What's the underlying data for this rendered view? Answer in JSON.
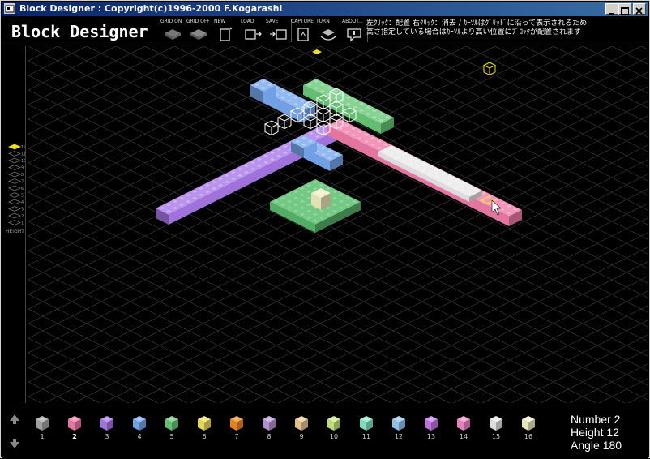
{
  "window": {
    "title": "Block Designer : Copyright(c)1996-2000  F.Kogarashi"
  },
  "toolbar": {
    "app_name": "Block Designer",
    "buttons": [
      {
        "id": "grid-on",
        "label": "GRID ON",
        "icon": "grid-on-icon"
      },
      {
        "id": "grid-off",
        "label": "GRID OFF",
        "icon": "grid-off-icon"
      },
      {
        "id": "new",
        "label": "NEW",
        "icon": "new-file-icon"
      },
      {
        "id": "load",
        "label": "LOAD",
        "icon": "load-icon"
      },
      {
        "id": "save",
        "label": "SAVE",
        "icon": "save-icon"
      },
      {
        "id": "capture",
        "label": "CAPTURE",
        "icon": "capture-icon"
      },
      {
        "id": "turn",
        "label": "TURN",
        "icon": "turn-icon"
      },
      {
        "id": "about",
        "label": "ABOUT...",
        "icon": "about-icon"
      }
    ],
    "help_line1": "左ｸﾘｯｸ：配置  右ｸﾘｯｸ：消去 / ｶｰｿﾙはｸﾞﾘｯﾄﾞに沿って表示されるため",
    "help_line2": "高さ指定している場合はｶｰｿﾙより高い位置にﾌﾞﾛｯｸが配置されます"
  },
  "height_panel": {
    "label": "HEIGHT",
    "levels": [
      "12",
      "11",
      "10",
      "9",
      "8",
      "7",
      "6",
      "5",
      "4",
      "3",
      "2",
      "1"
    ],
    "selected": "12"
  },
  "palette": {
    "selected": "2",
    "colors": [
      {
        "num": "1",
        "color": "#a8a8a8"
      },
      {
        "num": "2",
        "color": "#f07aa8"
      },
      {
        "num": "3",
        "color": "#a878e8"
      },
      {
        "num": "4",
        "color": "#78a8f0"
      },
      {
        "num": "5",
        "color": "#68c878"
      },
      {
        "num": "6",
        "color": "#f0e060"
      },
      {
        "num": "7",
        "color": "#f08820"
      },
      {
        "num": "8",
        "color": "#b898d8"
      },
      {
        "num": "9",
        "color": "#f0c890"
      },
      {
        "num": "10",
        "color": "#c8e880"
      },
      {
        "num": "11",
        "color": "#88e8c8"
      },
      {
        "num": "12",
        "color": "#98c8f0"
      },
      {
        "num": "13",
        "color": "#c878e8"
      },
      {
        "num": "14",
        "color": "#f088c8"
      },
      {
        "num": "15",
        "color": "#e8e8e8"
      },
      {
        "num": "16",
        "color": "#f0f0c8"
      }
    ]
  },
  "status": {
    "number": "Number 2",
    "height": "Height 12",
    "angle": "Angle 180"
  },
  "scene": {
    "cursor_color": "#f0e020",
    "grid_color": "#3a3a3a"
  }
}
